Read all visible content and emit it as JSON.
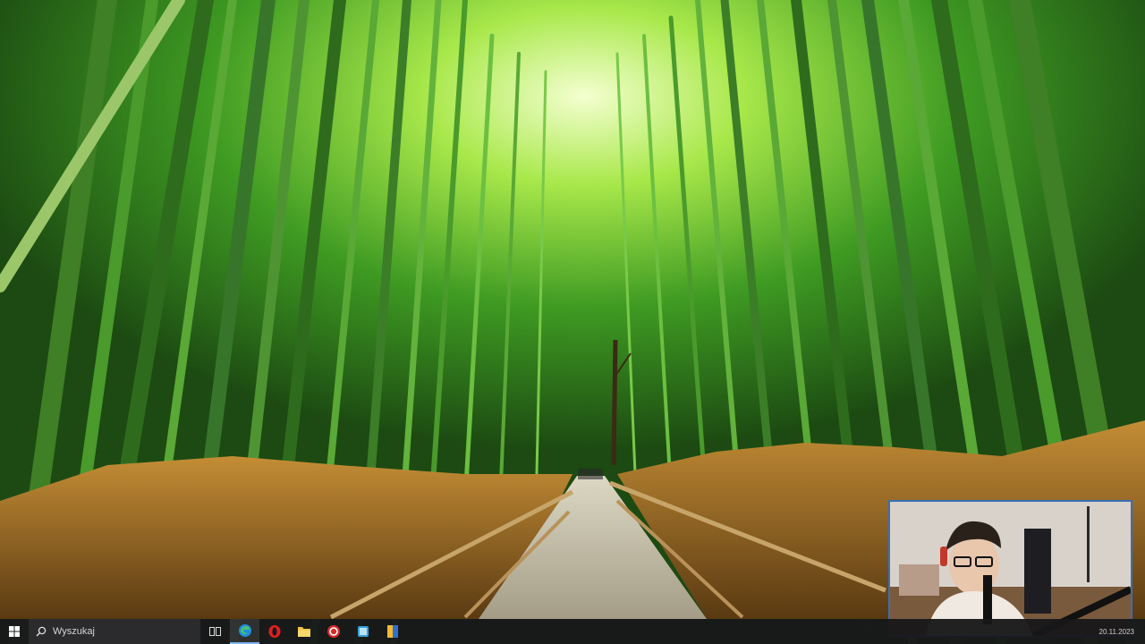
{
  "wallpaper": {
    "subject": "bamboo-grove-path",
    "colors": {
      "canopy": "#7ed321",
      "stalk": "#2f6b1c",
      "grass": "#b07a2a",
      "path": "#c8c2ad"
    }
  },
  "webcam": {
    "border_color": "#3a6fb5"
  },
  "taskbar": {
    "search_placeholder": "Wyszukaj",
    "apps": [
      {
        "name": "task-view",
        "icon": "task-view-icon"
      },
      {
        "name": "edge",
        "icon": "edge-icon",
        "active": true
      },
      {
        "name": "opera",
        "icon": "opera-icon"
      },
      {
        "name": "file-explorer",
        "icon": "folder-icon"
      },
      {
        "name": "app-red",
        "icon": "red-circle-icon"
      },
      {
        "name": "app-blue",
        "icon": "blue-app-icon"
      },
      {
        "name": "app-yellow-blue",
        "icon": "yellow-blue-app-icon"
      }
    ],
    "clock": "20.11.2023"
  }
}
